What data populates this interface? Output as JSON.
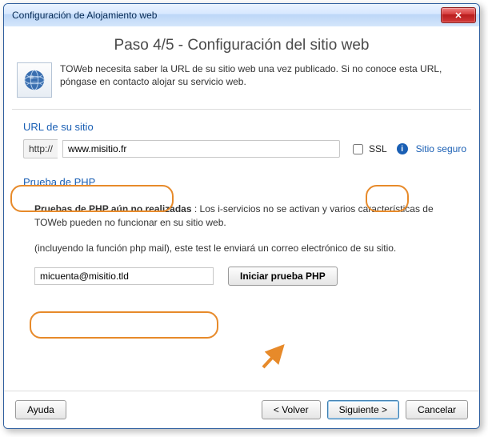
{
  "window": {
    "title": "Configuración de Alojamiento web"
  },
  "header": {
    "step_title": "Paso 4/5 - Configuración del sitio web",
    "intro": "TOWeb necesita saber la URL de su sitio web una vez publicado. Si no conoce esta URL, póngase en contacto alojar su servicio web."
  },
  "url_section": {
    "title": "URL de su sitio",
    "prefix": "http://",
    "value": "www.misitio.fr",
    "ssl_label": "SSL",
    "secure_link": "Sitio seguro"
  },
  "php_section": {
    "title": "Prueba de PHP",
    "status_bold": "Pruebas de PHP aún no realizadas",
    "status_rest": " : Los i-servicios no se activan y varios características de TOWeb pueden no funcionar en su sitio web.",
    "note": "(incluyendo la función php mail), este test le enviará un correo electrónico de su sitio.",
    "email_value": "micuenta@misitio.tld",
    "start_button": "Iniciar prueba PHP"
  },
  "footer": {
    "help": "Ayuda",
    "back": "< Volver",
    "next": "Siguiente >",
    "cancel": "Cancelar"
  }
}
